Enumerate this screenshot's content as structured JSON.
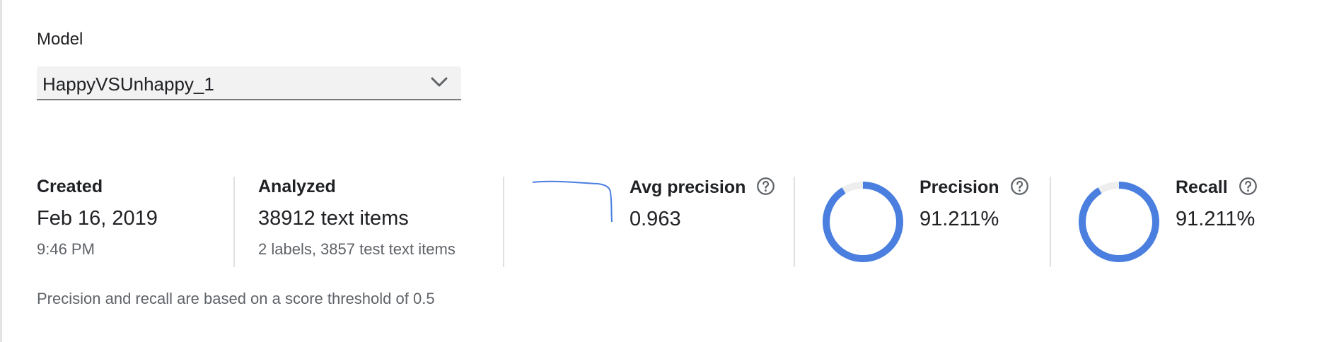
{
  "model": {
    "label": "Model",
    "selected": "HappyVSUnhappy_1"
  },
  "created": {
    "title": "Created",
    "date": "Feb 16, 2019",
    "time": "9:46 PM"
  },
  "analyzed": {
    "title": "Analyzed",
    "value": "38912 text items",
    "detail": "2 labels, 3857 test text items"
  },
  "avg_precision": {
    "title": "Avg precision",
    "value": "0.963"
  },
  "precision": {
    "title": "Precision",
    "value": "91.211%",
    "fraction": 0.91211
  },
  "recall": {
    "title": "Recall",
    "value": "91.211%",
    "fraction": 0.91211
  },
  "footnote": "Precision and recall are based on a score threshold of 0.5",
  "colors": {
    "accent": "#4a7fe0",
    "donut_track": "#eeeeee",
    "divider": "#e0e0e0"
  },
  "icons": {
    "dropdown": "chevron-down-icon",
    "help": "help-circle-icon"
  }
}
